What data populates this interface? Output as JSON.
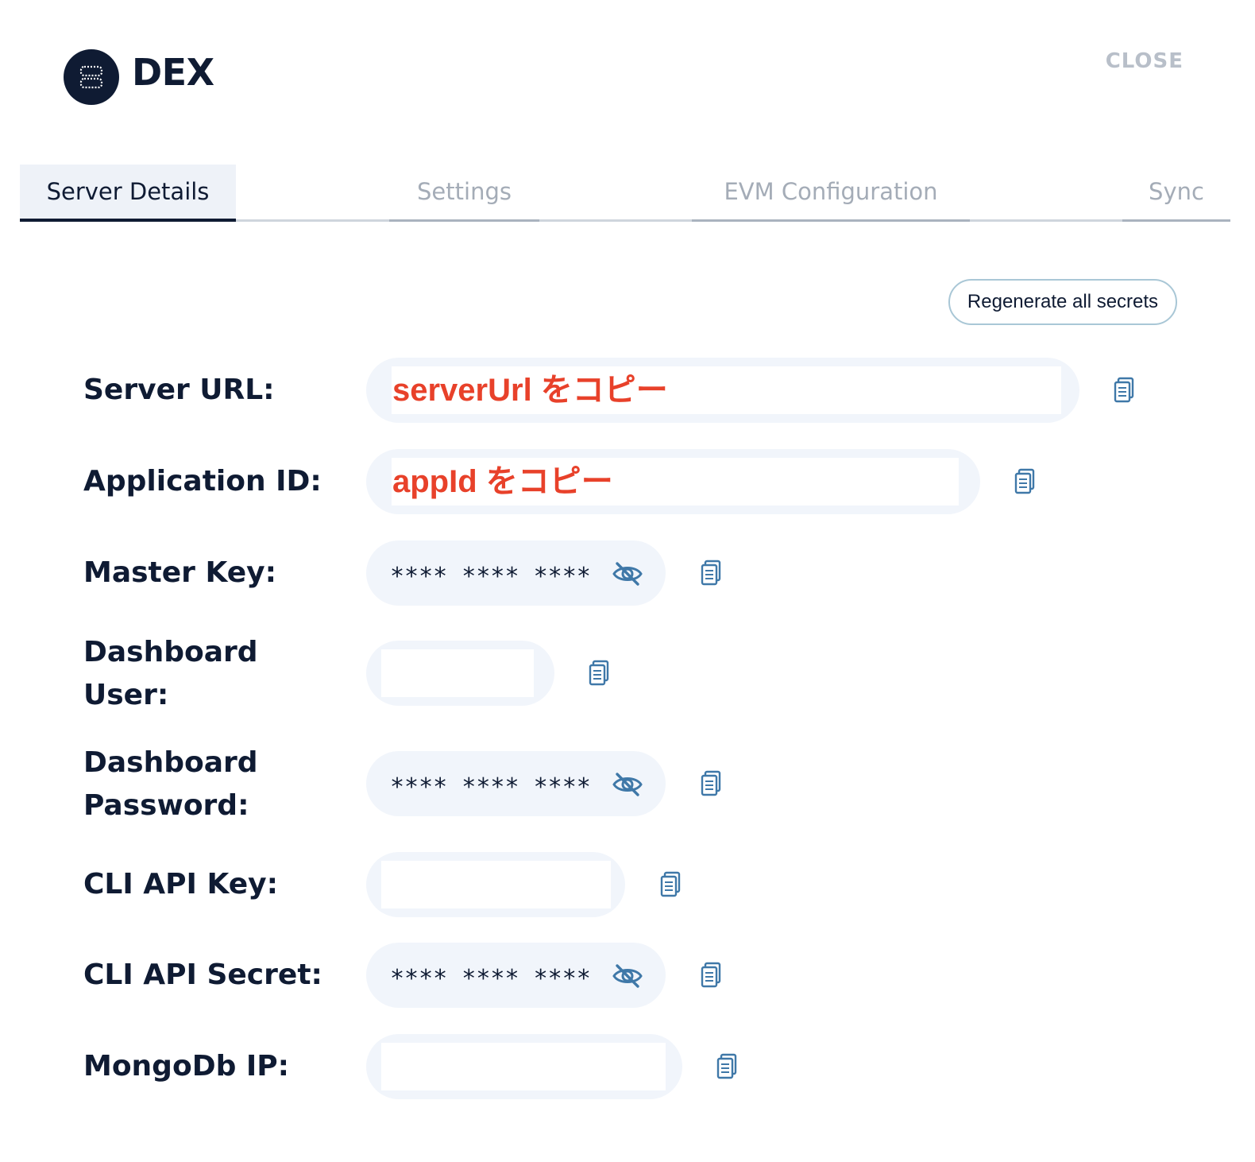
{
  "header": {
    "app_name": "DEX",
    "close_label": "CLOSE",
    "logo_icon": "server-icon"
  },
  "tabs": [
    {
      "label": "Server Details",
      "active": true
    },
    {
      "label": "Settings",
      "active": false
    },
    {
      "label": "EVM Configuration",
      "active": false
    },
    {
      "label": "Sync",
      "active": false
    }
  ],
  "actions": {
    "regenerate_label": "Regenerate all secrets"
  },
  "fields": {
    "server_url": {
      "label": "Server URL:",
      "value": "serverUrl をコピー",
      "copy_icon": "copy-icon"
    },
    "application_id": {
      "label": "Application ID:",
      "value": "appId をコピー",
      "copy_icon": "copy-icon"
    },
    "master_key": {
      "label": "Master Key:",
      "value": "**** **** ****",
      "toggle_icon": "eye-off-icon",
      "copy_icon": "copy-icon"
    },
    "dashboard_user": {
      "label_line1": "Dashboard",
      "label_line2": "User:",
      "value": "",
      "copy_icon": "copy-icon"
    },
    "dashboard_password": {
      "label_line1": "Dashboard",
      "label_line2": "Password:",
      "value": "**** **** ****",
      "toggle_icon": "eye-off-icon",
      "copy_icon": "copy-icon"
    },
    "cli_api_key": {
      "label": "CLI API Key:",
      "value": "",
      "copy_icon": "copy-icon"
    },
    "cli_api_secret": {
      "label": "CLI API Secret:",
      "value": "**** **** ****",
      "toggle_icon": "eye-off-icon",
      "copy_icon": "copy-icon"
    },
    "mongodb_ip": {
      "label": "MongoDb IP:",
      "value": "",
      "copy_icon": "copy-icon"
    }
  },
  "colors": {
    "primary_text": "#0f1b33",
    "accent_red": "#e8412a",
    "icon_blue": "#3f78a8",
    "field_bg": "#f1f5fb",
    "muted": "#b8bfc9"
  }
}
